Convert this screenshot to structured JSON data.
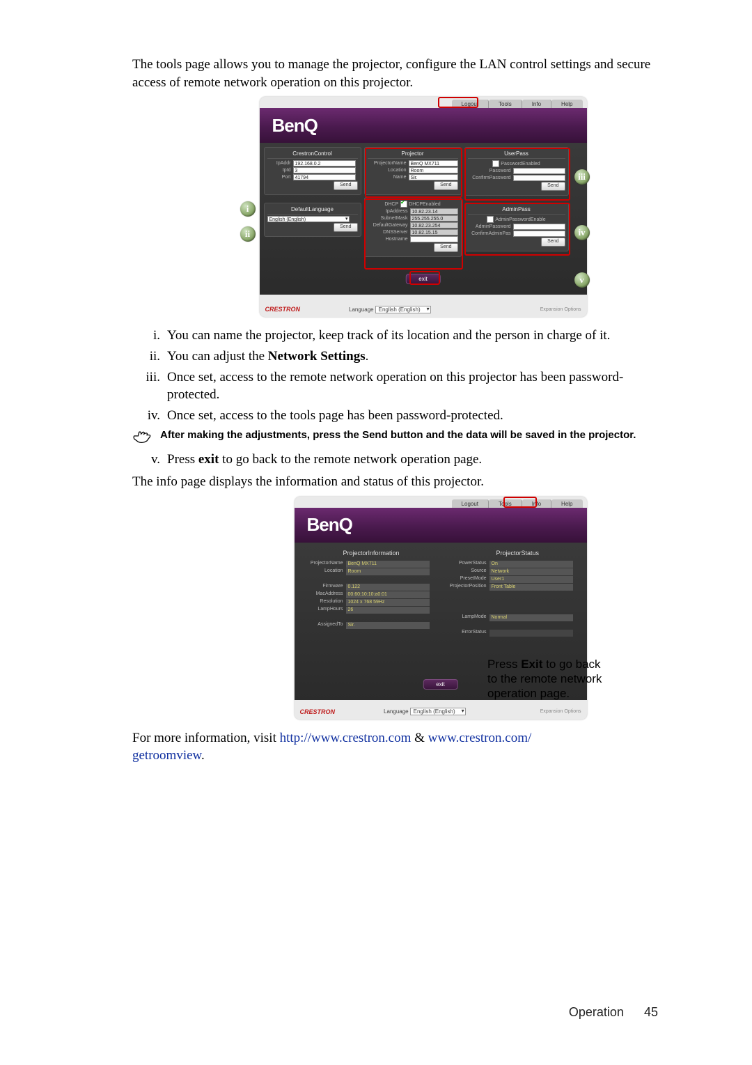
{
  "intro": "The tools page allows you to manage the projector, configure the LAN control settings and secure access of remote network operation on this projector.",
  "list": {
    "i": "You can name the projector, keep track of its location and the person in charge of it.",
    "ii_pre": "You can adjust the ",
    "ii_em": "Network Settings",
    "ii_post": ".",
    "iii": "Once set, access to the remote network operation on this projector has been password-protected.",
    "iv": "Once set, access to the tools page has been password-protected.",
    "v_pre": "Press ",
    "v_em": "exit",
    "v_post": " to go back to the remote network operation page."
  },
  "note": "After making the adjustments, press the Send button and the data will be saved in the projector.",
  "mid": "The info page displays the information and status of this projector.",
  "callout_pre": "Press ",
  "callout_em": "Exit",
  "callout_post": " to go back to the remote network operation page.",
  "outro_pre": "For more information, visit ",
  "outro_link1": "http://www.crestron.com",
  "outro_amp": " & ",
  "outro_link2a": "www.crestron.com/",
  "outro_link2b": "getroomview",
  "outro_post": ".",
  "footer": {
    "section": "Operation",
    "page": "45"
  },
  "tabs": {
    "logout": "Logout",
    "tools": "Tools",
    "info": "Info",
    "help": "Help"
  },
  "brand": "BenQ",
  "langlabel": "Language",
  "langsel": "English (English)",
  "expopt": "Expansion Options",
  "crestron": "CRESTRON",
  "tools": {
    "crestron": {
      "title": "CrestronControl",
      "ipaddr_l": "IpAddr",
      "ipaddr_v": "192.168.0.2",
      "ipid_l": "IpId",
      "ipid_v": "3",
      "port_l": "Port",
      "port_v": "41794",
      "send": "Send"
    },
    "deflang": {
      "title": "DefaultLanguage",
      "value": "English (English)",
      "send": "Send"
    },
    "proj": {
      "title": "Projector",
      "name_l": "ProjectorName",
      "name_v": "BenQ MX711",
      "loc_l": "Location",
      "loc_v": "Room",
      "asn_l": "Name",
      "asn_v": "Sir.",
      "send": "Send"
    },
    "net": {
      "dhcp_l": "DHCP",
      "dhcp_t": "DHCPEnabled",
      "ip_l": "IpAddress",
      "ip_v": "10.82.23.14",
      "mask_l": "SubnetMask",
      "mask_v": "255.255.255.0",
      "gw_l": "DefaultGateway",
      "gw_v": "10.82.23.254",
      "dns_l": "DNSServer",
      "dns_v": "10.82.15.15",
      "host_l": "Hostname",
      "host_v": "",
      "send": "Send"
    },
    "user": {
      "title": "UserPass",
      "enable": "PasswordEnabled",
      "pw_l": "Password",
      "cpw_l": "ConfirmPassword",
      "send": "Send"
    },
    "admin": {
      "title": "AdminPass",
      "enable": "AdminPasswordEnable",
      "pw_l": "AdminPassword",
      "cpw_l": "ConfirmAdminPas",
      "send": "Send"
    },
    "exit": "exit"
  },
  "info": {
    "left_h": "ProjectorInformation",
    "right_h": "ProjectorStatus",
    "name_l": "ProjectorName",
    "name_v": "BenQ MX711",
    "loc_l": "Location",
    "loc_v": "Room",
    "fw_l": "Firmware",
    "fw_v": "0.122",
    "mac_l": "MacAddress",
    "mac_v": "00:60:10:10:a0:01",
    "res_l": "Resolution",
    "res_v": "1024 x 768 59Hz",
    "lh_l": "LampHours",
    "lh_v": "26",
    "asn_l": "AssignedTo",
    "asn_v": "Sir.",
    "pow_l": "PowerStatus",
    "pow_v": "On",
    "src_l": "Source",
    "src_v": "Network",
    "pm_l": "PresetMode",
    "pm_v": "User1",
    "pp_l": "ProjectorPosition",
    "pp_v": "Front Table",
    "lm_l": "LampMode",
    "lm_v": "Normal",
    "err_l": "ErrorStatus",
    "exit": "exit"
  },
  "badges": {
    "i": "i",
    "ii": "ii",
    "iii": "iii",
    "iv": "iv",
    "v": "v"
  }
}
